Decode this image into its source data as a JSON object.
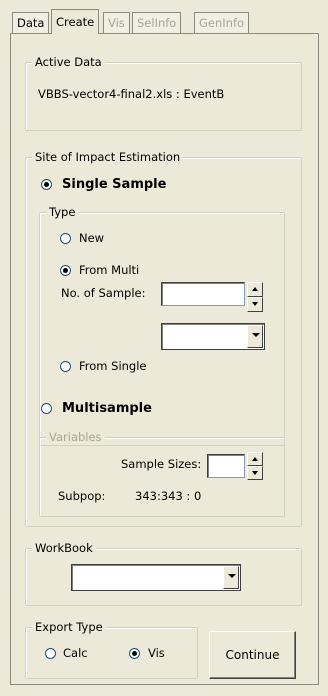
{
  "tabs": [
    {
      "label": "Data",
      "state": "normal"
    },
    {
      "label": "Create",
      "state": "active"
    },
    {
      "label": "Vis",
      "state": "disabled"
    },
    {
      "label": "SelInfo",
      "state": "disabled"
    },
    {
      "label": "GenInfo",
      "state": "disabled"
    }
  ],
  "active_data": {
    "legend": "Active Data",
    "value": "VBBS-vector4-final2.xls : EventB"
  },
  "site_of_impact": {
    "legend": "Site of Impact Estimation",
    "single_sample": {
      "label": "Single Sample",
      "selected": true,
      "type": {
        "legend": "Type",
        "new_label": "New",
        "from_multi_label": "From Multi",
        "no_of_sample_label": "No. of Sample:",
        "no_of_sample_value": "",
        "multi_select_value": "",
        "from_single_label": "From Single",
        "selected": "From Multi"
      }
    },
    "multisample": {
      "label": "Multisample",
      "selected": false,
      "variables": {
        "legend": "Variables",
        "sample_sizes_label": "Sample Sizes:",
        "sample_sizes_value": "",
        "subpop_label": "Subpop:",
        "subpop_value": "343:343 : 0"
      }
    }
  },
  "workbook": {
    "legend": "WorkBook",
    "value": ""
  },
  "export_type": {
    "legend": "Export Type",
    "calc_label": "Calc",
    "vis_label": "Vis",
    "selected": "Vis"
  },
  "continue_label": "Continue"
}
